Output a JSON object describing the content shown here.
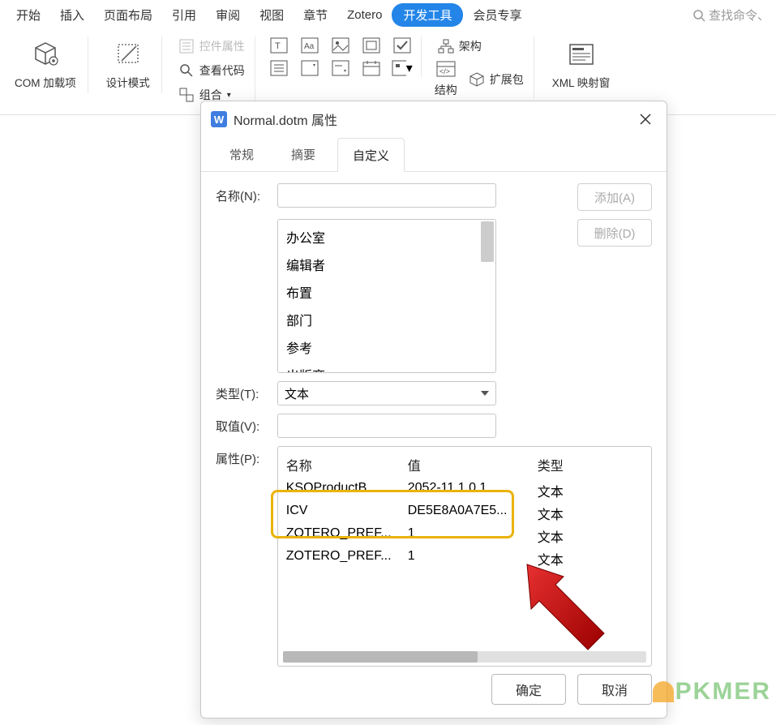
{
  "menu": {
    "items": [
      "开始",
      "插入",
      "页面布局",
      "引用",
      "审阅",
      "视图",
      "章节",
      "Zotero",
      "开发工具",
      "会员专享"
    ],
    "search_placeholder": "查找命令、"
  },
  "ribbon": {
    "com_addins": "COM 加载项",
    "design_mode": "设计模式",
    "control_props": "控件属性",
    "view_code": "查看代码",
    "group": "组合",
    "struct": "结构",
    "arch": "架构",
    "ext_pack": "扩展包",
    "xml_map": "XML 映射窗"
  },
  "dialog": {
    "title": "Normal.dotm 属性",
    "tabs": [
      "常规",
      "摘要",
      "自定义"
    ],
    "labels": {
      "name": "名称(N):",
      "type": "类型(T):",
      "value": "取值(V):",
      "props": "属性(P):"
    },
    "buttons": {
      "add": "添加(A)",
      "delete": "删除(D)",
      "ok": "确定",
      "cancel": "取消"
    },
    "type_value": "文本",
    "list_items": [
      "办公室",
      "编辑者",
      "布置",
      "部门",
      "参考",
      "出版商"
    ],
    "prop_headers": {
      "name": "名称",
      "value": "值",
      "type": "类型"
    },
    "prop_rows": [
      {
        "name": "KSOProductB...",
        "value": "2052-11.1.0.1...",
        "type": "文本"
      },
      {
        "name": "ICV",
        "value": "DE5E8A0A7E5...",
        "type": "文本"
      },
      {
        "name": "ZOTERO_PREF...",
        "value": "1",
        "type": "文本"
      },
      {
        "name": "ZOTERO_PREF...",
        "value": "1",
        "type": "文本"
      }
    ]
  },
  "watermark": "PKMER"
}
